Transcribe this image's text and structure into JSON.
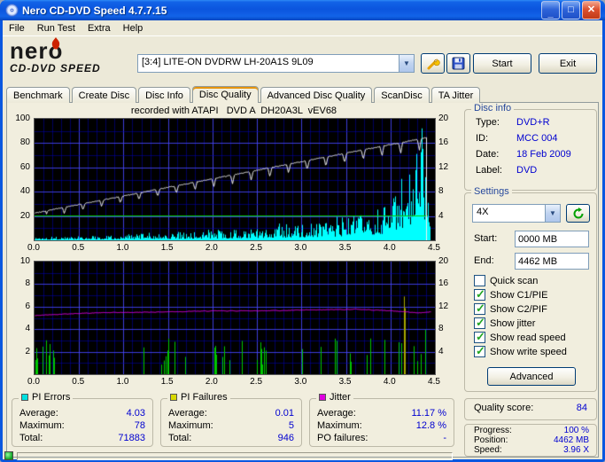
{
  "window": {
    "title": "Nero CD-DVD Speed 4.7.7.15"
  },
  "menu": {
    "items": [
      "File",
      "Run Test",
      "Extra",
      "Help"
    ]
  },
  "logo": {
    "brand": "nero",
    "product": "CD-DVD SPEED"
  },
  "toolbar": {
    "drive": "[3:4]  LITE-ON DVDRW LH-20A1S 9L09",
    "start": "Start",
    "exit": "Exit"
  },
  "tabs": [
    "Benchmark",
    "Create Disc",
    "Disc Info",
    "Disc Quality",
    "Advanced Disc Quality",
    "ScanDisc",
    "TA Jitter"
  ],
  "chart_header": "recorded with ATAPI   DVD A  DH20A3L  vEV68",
  "disc_info": {
    "title": "Disc info",
    "type_label": "Type:",
    "type": "DVD+R",
    "id_label": "ID:",
    "id": "MCC 004",
    "date_label": "Date:",
    "date": "18 Feb 2009",
    "label_label": "Label:",
    "label": "DVD"
  },
  "settings": {
    "title": "Settings",
    "speed": "4X",
    "start_label": "Start:",
    "start": "0000 MB",
    "end_label": "End:",
    "end": "4462 MB",
    "checks": [
      {
        "label": "Quick scan",
        "on": false
      },
      {
        "label": "Show C1/PIE",
        "on": true
      },
      {
        "label": "Show C2/PIF",
        "on": true
      },
      {
        "label": "Show jitter",
        "on": true
      },
      {
        "label": "Show read speed",
        "on": true
      },
      {
        "label": "Show write speed",
        "on": true
      }
    ],
    "advanced": "Advanced"
  },
  "quality": {
    "label": "Quality score:",
    "value": "84"
  },
  "progress": {
    "progress_label": "Progress:",
    "progress": "100 %",
    "position_label": "Position:",
    "position": "4462 MB",
    "speed_label": "Speed:",
    "speed": "3.96 X"
  },
  "stats": {
    "pie": {
      "title": "PI Errors",
      "color": "#00E0E0",
      "avg_label": "Average:",
      "avg": "4.03",
      "max_label": "Maximum:",
      "max": "78",
      "total_label": "Total:",
      "total": "71883"
    },
    "pif": {
      "title": "PI Failures",
      "color": "#D8D800",
      "avg_label": "Average:",
      "avg": "0.01",
      "max_label": "Maximum:",
      "max": "5",
      "total_label": "Total:",
      "total": "946"
    },
    "jitter": {
      "title": "Jitter",
      "color": "#E000E0",
      "avg_label": "Average:",
      "avg": "11.17 %",
      "max_label": "Maximum:",
      "max": "12.8 %",
      "total_label": "PO failures:",
      "total": "-"
    }
  },
  "chart_data": {
    "type": "bar",
    "x_axis": {
      "max": 4.5,
      "unit": "GB",
      "ticks": [
        "0.0",
        "0.5",
        "1.0",
        "1.5",
        "2.0",
        "2.5",
        "3.0",
        "3.5",
        "4.0",
        "4.5"
      ]
    },
    "top": {
      "title": "PI Errors / speed vs position",
      "left_axis": {
        "max": 100,
        "ticks": [
          100,
          80,
          60,
          40,
          20
        ]
      },
      "right_axis": {
        "max": 20,
        "ticks": [
          20,
          16,
          12,
          8,
          4
        ]
      },
      "series": [
        {
          "name": "pi-errors",
          "type": "bars",
          "color": "#00FFFF",
          "scale": "left",
          "seed": 1337,
          "noise_floor": 0.18,
          "envelope": [
            [
              0,
              2.6
            ],
            [
              0.4,
              3.4
            ],
            [
              0.8,
              4.4
            ],
            [
              1.2,
              5.4
            ],
            [
              1.6,
              6.6
            ],
            [
              2.0,
              7.8
            ],
            [
              2.4,
              9.6
            ],
            [
              2.8,
              12
            ],
            [
              3.1,
              14
            ],
            [
              3.4,
              17
            ],
            [
              3.7,
              22
            ],
            [
              3.9,
              28
            ],
            [
              4.05,
              38
            ],
            [
              4.18,
              52
            ],
            [
              4.28,
              70
            ],
            [
              4.36,
              97
            ],
            [
              4.42,
              88
            ],
            [
              4.45,
              55
            ]
          ]
        },
        {
          "name": "read-speed",
          "type": "line",
          "color": "#00D200",
          "scale": "right",
          "points": [
            [
              0,
              4.02
            ],
            [
              4.42,
              4.02
            ]
          ]
        },
        {
          "name": "write-speed",
          "type": "line-dips",
          "color": "#F0F0F0",
          "scale": "right",
          "start": [
            0,
            4.5
          ],
          "end": [
            4.4,
            16.9
          ],
          "dip_interval": 0.21,
          "dip_depth": 1.9,
          "dip_halfwidth": 0.022,
          "end_drop": true
        }
      ]
    },
    "bottom": {
      "title": "PI Failures / jitter vs position",
      "left_axis": {
        "max": 10,
        "ticks": [
          10,
          8,
          6,
          4,
          2
        ]
      },
      "right_axis": {
        "max": 20,
        "ticks": [
          20,
          16,
          12,
          8,
          4
        ]
      },
      "series": [
        {
          "name": "pi-failures",
          "type": "spikes",
          "color": "#00C800",
          "scale": "left",
          "seed": 777,
          "base_p": 0.045,
          "ramp_from": 3.0,
          "ramp_p": 0.09,
          "h_min": 0.8,
          "h_max": 3.2,
          "end_h_max": 5.0,
          "clusters": [
            {
              "c": 0.06,
              "w": 0.09,
              "p": 0.5
            },
            {
              "c": 1.5,
              "w": 0.07,
              "p": 0.28
            },
            {
              "c": 2.06,
              "w": 0.06,
              "p": 0.3
            },
            {
              "c": 2.55,
              "w": 0.05,
              "p": 0.2
            },
            {
              "c": 4.38,
              "w": 0.07,
              "p": 0.55
            }
          ]
        },
        {
          "name": "jitter-max-spike",
          "type": "bar-single",
          "color": "#A8A800",
          "scale": "left",
          "x": 4.15,
          "h": 6.9
        },
        {
          "name": "jitter",
          "type": "wavy-line",
          "color": "#E600E6",
          "scale": "right",
          "seed": 42,
          "noise": 0.14,
          "points": [
            [
              0,
              10.4
            ],
            [
              0.3,
              10.7
            ],
            [
              0.7,
              10.9
            ],
            [
              1.2,
              11.0
            ],
            [
              1.7,
              11.15
            ],
            [
              2.2,
              11.25
            ],
            [
              2.7,
              11.3
            ],
            [
              3.2,
              11.4
            ],
            [
              3.6,
              11.55
            ],
            [
              3.9,
              11.35
            ],
            [
              4.15,
              11.1
            ],
            [
              4.3,
              10.9
            ],
            [
              4.45,
              11.05
            ]
          ]
        }
      ]
    }
  }
}
